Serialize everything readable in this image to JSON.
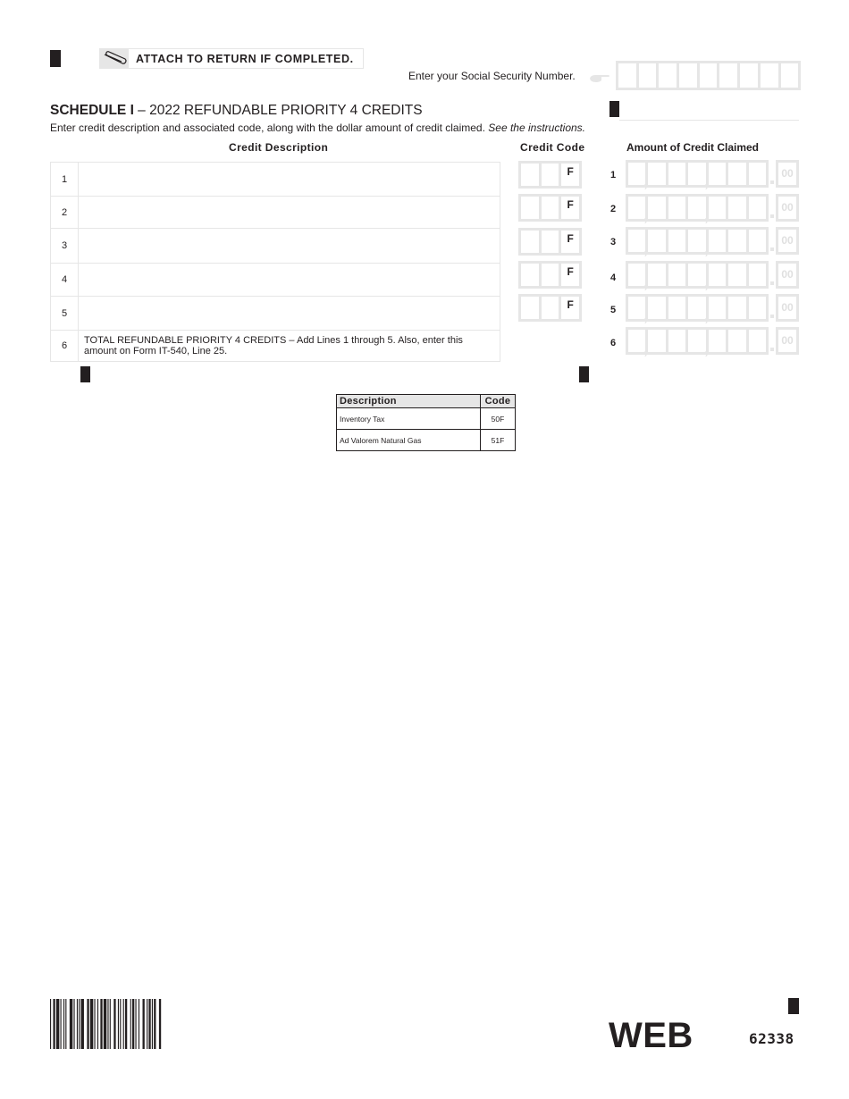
{
  "header": {
    "attach_notice": "ATTACH TO RETURN IF COMPLETED.",
    "ssn_label": "Enter your Social Security Number.",
    "ssn_digits": [
      "",
      "",
      "",
      "",
      "",
      "",
      "",
      "",
      ""
    ]
  },
  "schedule": {
    "title_bold": "SCHEDULE I",
    "title_rest": " – 2022 REFUNDABLE PRIORITY 4 CREDITS",
    "instructions": "Enter credit description and associated code, along with the dollar amount of credit claimed. ",
    "instructions_italic": "See the instructions."
  },
  "columns": {
    "description": "Credit Description",
    "code": "Credit Code",
    "amount": "Amount of Credit Claimed"
  },
  "lines": [
    {
      "num": "1",
      "description": "",
      "code_suffix": "F",
      "amount_cents": "00"
    },
    {
      "num": "2",
      "description": "",
      "code_suffix": "F",
      "amount_cents": "00"
    },
    {
      "num": "3",
      "description": "",
      "code_suffix": "F",
      "amount_cents": "00"
    },
    {
      "num": "4",
      "description": "",
      "code_suffix": "F",
      "amount_cents": "00"
    },
    {
      "num": "5",
      "description": "",
      "code_suffix": "F",
      "amount_cents": "00"
    },
    {
      "num": "6",
      "description": "TOTAL REFUNDABLE PRIORITY 4 CREDITS – Add Lines 1 through 5. Also, enter this amount on Form IT-540, Line 25.",
      "amount_cents": "00"
    }
  ],
  "reference_table": {
    "headers": [
      "Description",
      "Code"
    ],
    "rows": [
      {
        "description": "Inventory Tax",
        "code": "50F"
      },
      {
        "description": "Ad Valorem Natural Gas",
        "code": "51F"
      }
    ]
  },
  "footer": {
    "web_label": "WEB",
    "form_number": "62338"
  }
}
